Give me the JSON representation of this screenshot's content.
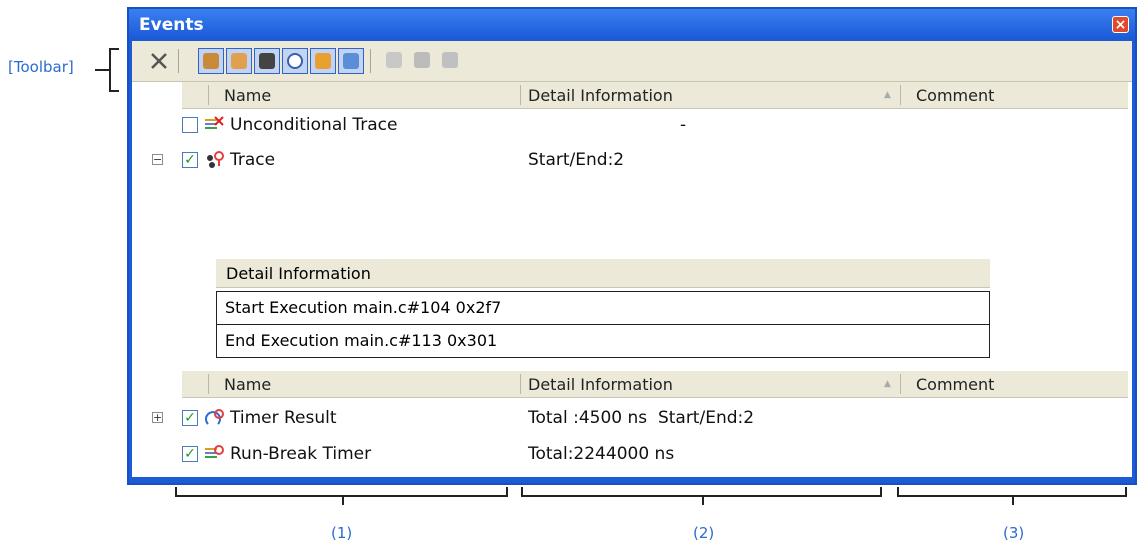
{
  "annotations": {
    "toolbar": "[Toolbar]",
    "col1": "(1)",
    "col2": "(2)",
    "col3": "(3)"
  },
  "window": {
    "title": "Events",
    "close": "×"
  },
  "toolbar": {
    "buttons": [
      "delete-icon",
      "hand-stop-icon",
      "hand-icon",
      "footprint-icon",
      "timer-icon",
      "trace-icon",
      "window-icon",
      "edit-icon",
      "copy-icon",
      "paste-icon"
    ]
  },
  "columns": {
    "name": "Name",
    "detail": "Detail Information",
    "comment": "Comment",
    "sort": "▲"
  },
  "group1": {
    "rows": [
      {
        "name": "Unconditional Trace",
        "detail": "-",
        "checked": false
      },
      {
        "name": "Trace",
        "detail": "Start/End:2",
        "checked": true,
        "expander": "−"
      }
    ],
    "sub": {
      "header": "Detail Information",
      "rows": [
        "Start Execution main.c#104 0x2f7",
        "End Execution main.c#113 0x301"
      ]
    }
  },
  "group2": {
    "rows": [
      {
        "name": "Timer Result",
        "detail": "Total :4500 ns  Start/End:2",
        "checked": true,
        "expander": "+"
      },
      {
        "name": "Run-Break Timer",
        "detail": "Total:2244000 ns",
        "checked": true
      }
    ]
  },
  "check_mark": "✓"
}
